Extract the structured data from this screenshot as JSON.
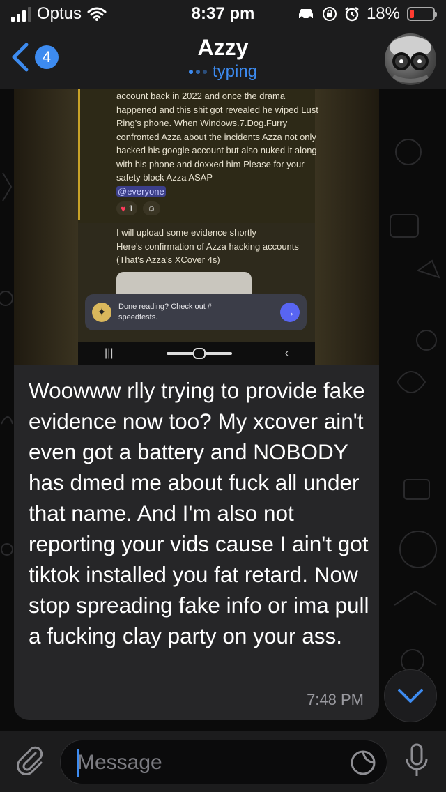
{
  "status_bar": {
    "carrier": "Optus",
    "time": "8:37 pm",
    "battery_percent": "18%",
    "battery_level": 0.18
  },
  "header": {
    "back_count": "4",
    "title": "Azzy",
    "status": "typing"
  },
  "message": {
    "media": {
      "post_text": "account back in 2022 and once the drama happened and this shit got revealed he wiped Lust Ring's phone. When Windows.7.Dog.Furry confronted Azza about the incidents Azza not only hacked his google account but also nuked it along with his phone and doxxed him Please for your safety block Azza ASAP",
      "mention": "@everyone",
      "reaction_count": "1",
      "followup_line1": "I will upload some evidence shortly",
      "followup_line2": "Here's confirmation of Azza hacking accounts",
      "followup_line3": "(That's Azza's XCover 4s)",
      "toast_line1": "Done reading? Check out #",
      "toast_line2": "speedtests."
    },
    "text": "Woowww rlly trying to provide fake evidence now too? My xcover ain't even got a battery and NOBODY has dmed me about fuck all under that name. And I'm also not reporting your vids cause I ain't got tiktok installed you fat retard. Now stop spreading fake info or ima pull a fucking clay party on your ass.",
    "time": "7:48 PM"
  },
  "input": {
    "placeholder": "Message"
  },
  "colors": {
    "accent": "#3d8bf0",
    "bubble": "#262628",
    "header_bg": "#1c1c1d",
    "battery_low": "#ff3b30"
  },
  "icons": {
    "signal": "signal-bars-icon",
    "wifi": "wifi-icon",
    "car": "car-icon",
    "rotation_lock": "rotation-lock-icon",
    "alarm": "alarm-icon",
    "back": "chevron-left-icon",
    "attach": "paperclip-icon",
    "sticker": "sticker-icon",
    "mic": "microphone-icon",
    "scroll": "chevron-down-icon"
  }
}
